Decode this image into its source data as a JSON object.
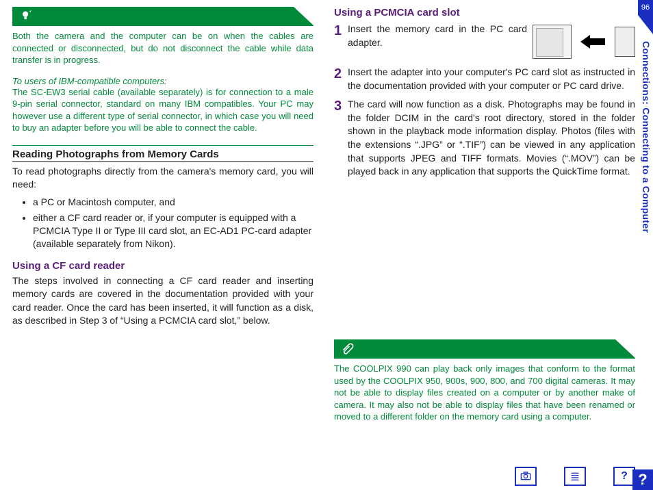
{
  "page_number": "96",
  "side_label": "Connections: Connecting to a Computer",
  "left": {
    "tip": "Both the camera and the computer can be on when the cables are connected or disconnected, but do not disconnect the cable while data transfer is in progress.",
    "ibm_heading": "To users of IBM-compatible computers:",
    "ibm_body": "The SC-EW3 serial cable (available separately) is for connection to a male 9-pin serial connector, standard on many IBM compatibles.  Your PC may however use a different type of serial connector, in which case you will need to buy an adapter before you will be able to connect the cable.",
    "read_heading": "Reading Photographs from Memory Cards",
    "read_intro": "To read photographs directly from the camera's memory card, you will need:",
    "bullets": [
      "a PC or Macintosh computer, and",
      "either a CF card reader or, if your computer is equipped with a PCMCIA Type II or Type III card slot, an EC-AD1 PC-card adapter (available separately from Nikon)."
    ],
    "cf_heading": "Using a CF card reader",
    "cf_body": "The steps involved in connecting a CF card reader and inserting memory cards are covered in the documentation provided with your card reader.  Once the card has been inserted, it will function as a disk, as described in Step 3 of “Using a PCMCIA card slot,” below."
  },
  "right": {
    "pcmcia_heading": "Using a PCMCIA card slot",
    "steps": [
      "Insert the memory card in the PC card adapter.",
      "Insert the adapter into your computer's PC card slot as instructed in the documentation provided with your computer or PC card drive.",
      "The card will now function as a disk.  Photographs may be found in the folder DCIM in the card's root directory, stored in the folder shown in the playback mode information display.  Photos (files with the extensions “.JPG” or “.TIF”) can be viewed in any application that supports JPEG and TIFF formats.  Movies (“.MOV”) can be played back in any application that supports the QuickTime format."
    ],
    "note": "The COOLPIX 990 can play back only images that conform to the format used by the COOLPIX 950, 900s, 900, 800, and 700 digital cameras.  It may not be able to display files created on a computer or by another make of camera.  It may also not be able to display files that have been renamed or moved to a different folder on the memory card using a computer."
  },
  "nav": {
    "camera_icon": "camera",
    "toc_icon": "contents",
    "help_icon": "help-box",
    "corner_help": "?"
  }
}
